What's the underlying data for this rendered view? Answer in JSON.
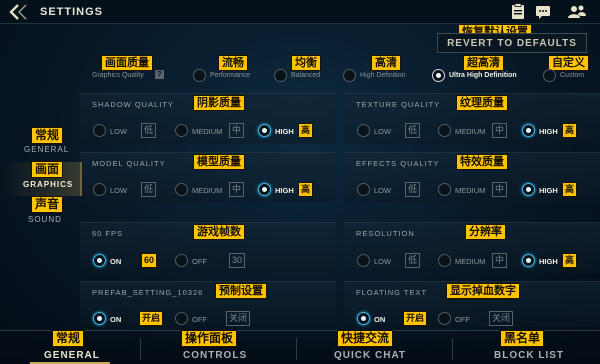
{
  "header": {
    "title": "SETTINGS",
    "icons": [
      "back-arrow-icon",
      "clipboard-icon",
      "chat-icon",
      "friends-icon"
    ]
  },
  "revert": {
    "label": "REVERT TO DEFAULTS",
    "cn": "恢复默认设置"
  },
  "preset": {
    "cn": "画面质量",
    "label": "Graphics Quality",
    "options": [
      {
        "label": "Performance",
        "cn": "流畅"
      },
      {
        "label": "Balanced",
        "cn": "均衡"
      },
      {
        "label": "High Definition",
        "cn": "高清"
      },
      {
        "label": "Ultra High Definition",
        "cn": "超高清"
      },
      {
        "label": "Custom",
        "cn": "自定义"
      }
    ],
    "selected": "Ultra High Definition"
  },
  "side_nav": [
    {
      "label": "GENERAL",
      "cn": "常规"
    },
    {
      "label": "GRAPHICS",
      "cn": "画面"
    },
    {
      "label": "SOUND",
      "cn": "声音"
    }
  ],
  "settings": {
    "shadow": {
      "label": "SHADOW QUALITY",
      "cn": "阴影质量",
      "low": "LOW",
      "low_cn": "低",
      "medium": "MEDIUM",
      "medium_cn": "中",
      "high": "HIGH",
      "high_cn": "高",
      "selected": "HIGH"
    },
    "texture": {
      "label": "TEXTURE QUALITY",
      "cn": "纹理质量",
      "low": "LOW",
      "low_cn": "低",
      "medium": "MEDIUM",
      "medium_cn": "中",
      "high": "HIGH",
      "high_cn": "高",
      "selected": "HIGH"
    },
    "model": {
      "label": "MODEL QUALITY",
      "cn": "模型质量",
      "low": "LOW",
      "low_cn": "低",
      "medium": "MEDIUM",
      "medium_cn": "中",
      "high": "HIGH",
      "high_cn": "高",
      "selected": "HIGH"
    },
    "effects": {
      "label": "EFFECTS QUALITY",
      "cn": "特效质量",
      "low": "LOW",
      "low_cn": "低",
      "medium": "MEDIUM",
      "medium_cn": "中",
      "high": "HIGH",
      "high_cn": "高",
      "selected": "HIGH"
    },
    "fps": {
      "label": "60 FPS",
      "cn": "游戏帧数",
      "on": "ON",
      "on_val": "60",
      "off": "OFF",
      "off_val": "30",
      "selected": "ON"
    },
    "resolution": {
      "label": "RESOLUTION",
      "cn": "分辨率",
      "low": "LOW",
      "low_cn": "低",
      "medium": "MEDIUM",
      "medium_cn": "中",
      "high": "HIGH",
      "high_cn": "高",
      "selected": "HIGH"
    },
    "prefab": {
      "label": "PREFAB_SETTING_10326",
      "cn": "预制设置",
      "on": "ON",
      "on_cn": "开启",
      "off": "OFF",
      "off_cn": "关闭",
      "selected": "ON"
    },
    "floating_text": {
      "label": "FLOATING TEXT",
      "cn": "显示掉血数字",
      "on": "ON",
      "on_cn": "开启",
      "off": "OFF",
      "off_cn": "关闭",
      "selected": "ON"
    }
  },
  "bottom_nav": [
    {
      "label": "GENERAL",
      "cn": "常规"
    },
    {
      "label": "CONTROLS",
      "cn": "操作面板"
    },
    {
      "label": "QUICK CHAT",
      "cn": "快捷交流"
    },
    {
      "label": "BLOCK LIST",
      "cn": "黑名单"
    }
  ],
  "colors": {
    "highlight": "#ffc400",
    "radio_on": "#43b9e3",
    "background": "#071726",
    "gold_accent": "#c9a85a"
  }
}
